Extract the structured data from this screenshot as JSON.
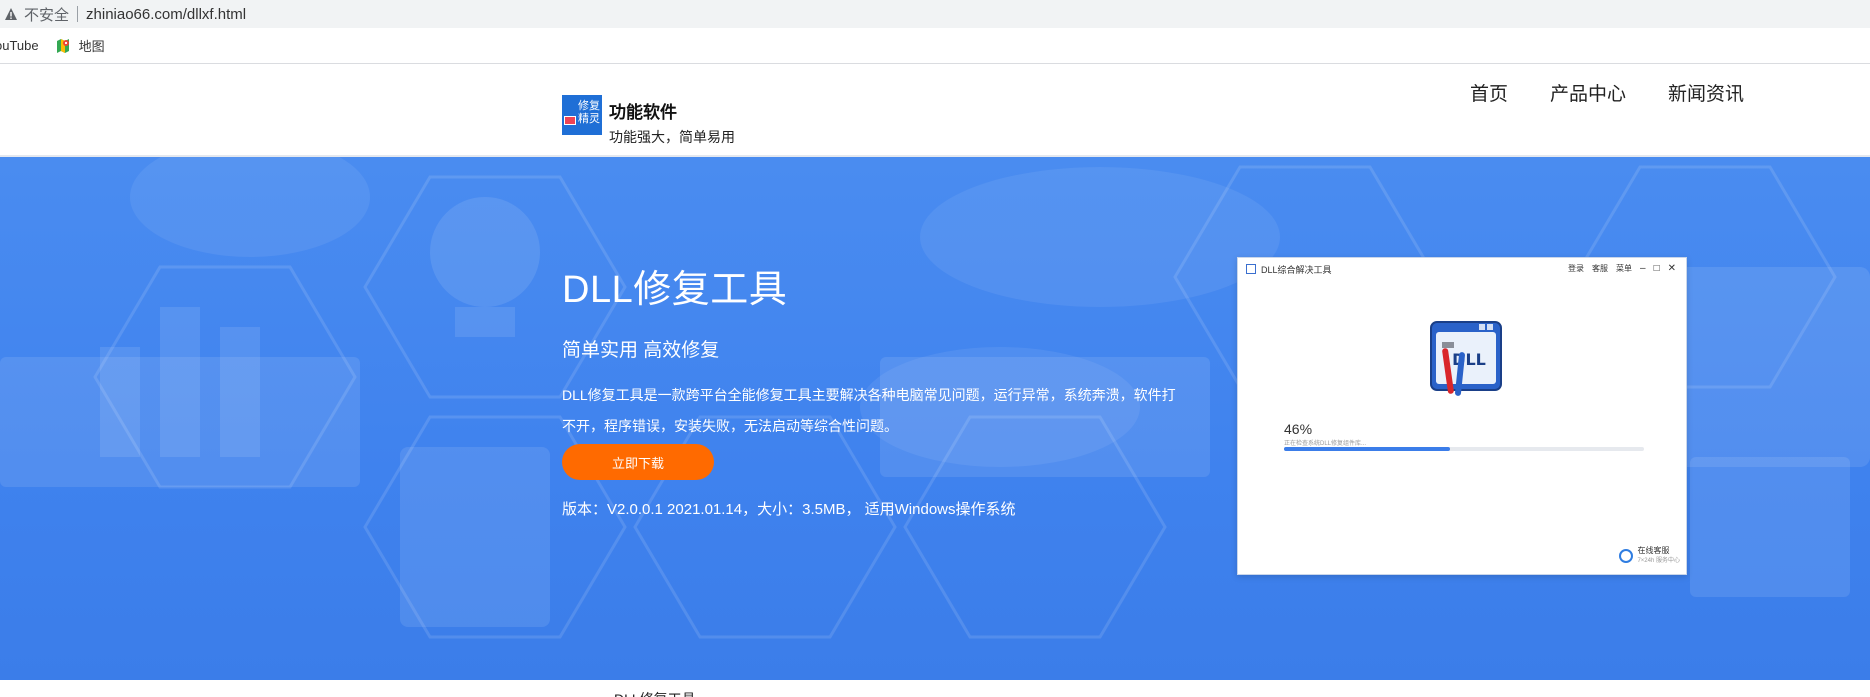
{
  "browser": {
    "insecure_label": "不安全",
    "url": "zhiniao66.com/dllxf.html",
    "bookmarks": [
      {
        "label": "ouTube"
      },
      {
        "label": "地图"
      }
    ]
  },
  "header": {
    "logo_text_1": "修复",
    "logo_text_2": "精灵",
    "brand_name": "功能软件",
    "brand_tagline": "功能强大，简单易用",
    "nav": [
      "首页",
      "产品中心",
      "新闻资讯"
    ]
  },
  "hero": {
    "title": "DLL修复工具",
    "subtitle": "简单实用 高效修复",
    "description": "DLL修复工具是一款跨平台全能修复工具主要解决各种电脑常见问题，运行异常，系统奔溃，软件打不开，程序错误，安装失败，无法启动等综合性问题。",
    "download_button": "立即下载",
    "version_info": "版本：V2.0.0.1 2021.01.14，大小：3.5MB， 适用Windows操作系统"
  },
  "app_window": {
    "title": "DLL综合解决工具",
    "actions": [
      "登录",
      "客服",
      "菜单"
    ],
    "window_controls": [
      "–",
      "□",
      "✕"
    ],
    "icon_text": "DLL",
    "progress_percent": 46,
    "progress_label": "46%",
    "progress_sub": "正在检查系统DLL修复组件库...",
    "support_label": "在线客服",
    "support_sub": "7×24h 服务中心"
  },
  "below_fold": {
    "text": "DLL修复工具"
  },
  "colors": {
    "banner_blue": "#4a8cf0",
    "button_orange": "#ff6a00",
    "logo_blue": "#1f6fd6"
  }
}
